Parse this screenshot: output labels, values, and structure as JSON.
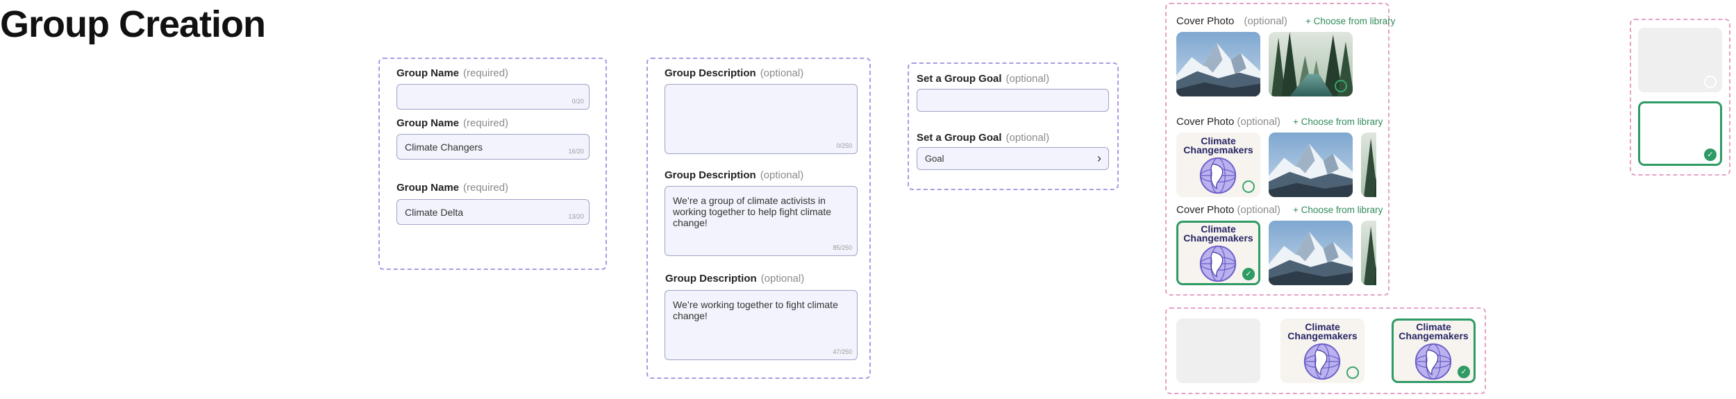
{
  "page_title": "Group Creation",
  "group_name": {
    "label": "Group Name",
    "optional_note": "(required)",
    "fields": [
      {
        "value": "",
        "count": "0/20"
      },
      {
        "value": "Climate Changers",
        "count": "16/20"
      },
      {
        "value": "Climate Delta",
        "count": "13/20"
      }
    ]
  },
  "group_description": {
    "label": "Group Description",
    "optional_note": "(optional)",
    "fields": [
      {
        "value": "",
        "count": "0/250"
      },
      {
        "value": "We’re a group of climate activists in working together to help fight climate change!",
        "count": "85/250"
      },
      {
        "value": "We’re working together to fight climate change!",
        "count": "47/250"
      }
    ]
  },
  "group_goal": {
    "label": "Set a Group Goal",
    "optional_note": "(optional)",
    "fields": [
      {
        "value": ""
      },
      {
        "value": "Goal"
      }
    ]
  },
  "cover_photo": {
    "label": "Cover Photo",
    "optional_note": "(optional)",
    "choose_link": "+ Choose from library",
    "logo_line1": "Climate",
    "logo_line2": "Changemakers",
    "selected_mark": "✓"
  },
  "colors": {
    "frame_purple": "#a99be6",
    "frame_pink": "#e3a2c4",
    "field_bg": "#f2f3fc",
    "link_green": "#2f8a5a",
    "selected_green": "#2e9a64"
  }
}
